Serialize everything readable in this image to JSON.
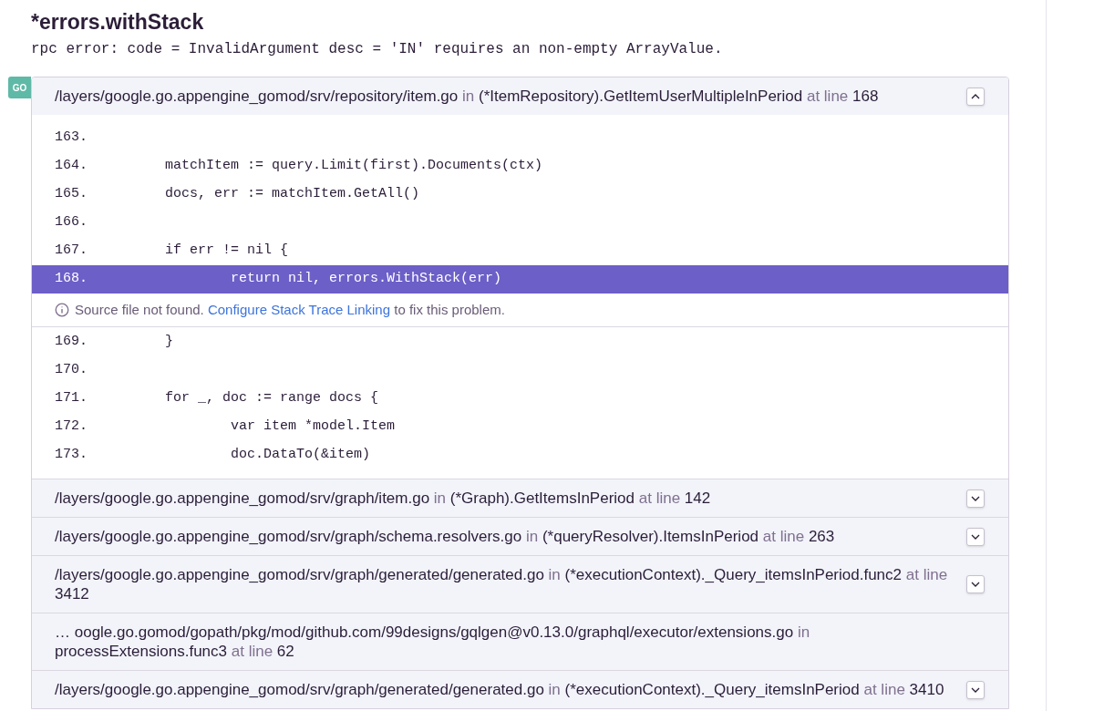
{
  "exception": {
    "type": "*errors.withStack",
    "value": "rpc error: code = InvalidArgument desc = 'IN' requires an non-empty ArrayValue."
  },
  "platform_badge": "GO",
  "frames": [
    {
      "file": "/layers/google.go.appengine_gomod/srv/repository/item.go",
      "in_label": "in",
      "function": "(*ItemRepository).GetItemUserMultipleInPeriod",
      "line_label": "at line",
      "line": "168",
      "expanded": true,
      "context": [
        {
          "kind": "code",
          "number": "163.",
          "highlighted": false
        },
        {
          "kind": "code",
          "number": "164.",
          "code": "\tmatchItem := query.Limit(first).Documents(ctx)",
          "highlighted": false
        },
        {
          "kind": "code",
          "number": "165.",
          "code": "\tdocs, err := matchItem.GetAll()",
          "highlighted": false
        },
        {
          "kind": "code",
          "number": "166.",
          "highlighted": false
        },
        {
          "kind": "code",
          "number": "167.",
          "code": "\tif err != nil {",
          "highlighted": false
        },
        {
          "kind": "code",
          "number": "168.",
          "code": "\t\treturn nil, errors.WithStack(err)",
          "highlighted": true
        },
        {
          "kind": "notice",
          "before": "Source file not found.",
          "link": "Configure Stack Trace Linking",
          "after": "to fix this problem."
        },
        {
          "kind": "code",
          "number": "169.",
          "code": "\t}",
          "highlighted": false
        },
        {
          "kind": "code",
          "number": "170.",
          "highlighted": false
        },
        {
          "kind": "code",
          "number": "171.",
          "code": "\tfor _, doc := range docs {",
          "highlighted": false
        },
        {
          "kind": "code",
          "number": "172.",
          "code": "\t\tvar item *model.Item",
          "highlighted": false
        },
        {
          "kind": "code",
          "number": "173.",
          "code": "\t\tdoc.DataTo(&item)",
          "highlighted": false
        }
      ]
    },
    {
      "file": "/layers/google.go.appengine_gomod/srv/graph/item.go",
      "in_label": "in",
      "function": "(*Graph).GetItemsInPeriod",
      "line_label": "at line",
      "line": "142",
      "expanded": false
    },
    {
      "file": "/layers/google.go.appengine_gomod/srv/graph/schema.resolvers.go",
      "in_label": "in",
      "function": "(*queryResolver).ItemsInPeriod",
      "line_label": "at line",
      "line": "263",
      "expanded": false
    },
    {
      "file": "/layers/google.go.appengine_gomod/srv/graph/generated/generated.go",
      "in_label": "in",
      "function": "(*executionContext)._Query_itemsInPeriod.func2",
      "line_label": "at line",
      "line": "3412",
      "expanded": false
    },
    {
      "file": "… oogle.go.gomod/gopath/pkg/mod/github.com/99designs/gqlgen@v0.13.0/graphql/executor/extensions.go",
      "in_label": "in",
      "function": "processExtensions.func3",
      "line_label": "at line",
      "line": "62"
    },
    {
      "file": "/layers/google.go.appengine_gomod/srv/graph/generated/generated.go",
      "in_label": "in",
      "function": "(*executionContext)._Query_itemsInPeriod",
      "line_label": "at line",
      "line": "3410",
      "expanded": false
    }
  ]
}
